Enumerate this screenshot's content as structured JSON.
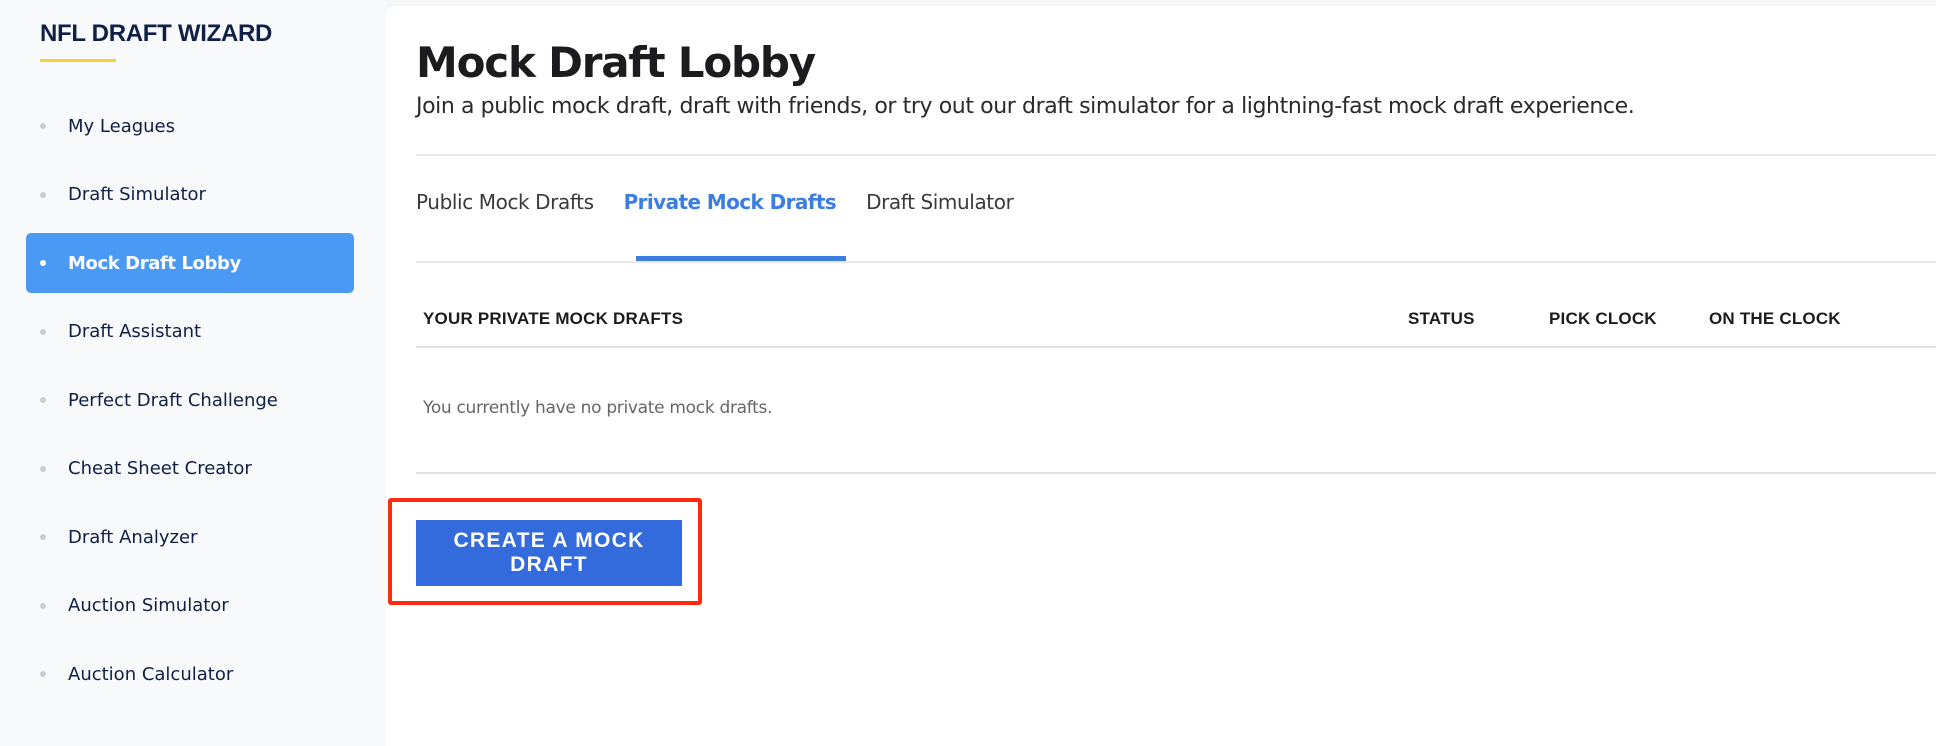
{
  "sidebar": {
    "logo": "NFL DRAFT WIZARD",
    "accent_color": "#f4cf3e",
    "active_color": "#4a9af5",
    "items": [
      {
        "label": "My Leagues",
        "active": false
      },
      {
        "label": "Draft Simulator",
        "active": false
      },
      {
        "label": "Mock Draft Lobby",
        "active": true
      },
      {
        "label": "Draft Assistant",
        "active": false
      },
      {
        "label": "Perfect Draft Challenge",
        "active": false
      },
      {
        "label": "Cheat Sheet Creator",
        "active": false
      },
      {
        "label": "Draft Analyzer",
        "active": false
      },
      {
        "label": "Auction Simulator",
        "active": false
      },
      {
        "label": "Auction Calculator",
        "active": false
      }
    ]
  },
  "main": {
    "title": "Mock Draft Lobby",
    "subtitle": "Join a public mock draft, draft with friends, or try out our draft simulator for a lightning-fast mock draft experience.",
    "tabs": [
      {
        "label": "Public Mock Drafts",
        "active": false
      },
      {
        "label": "Private Mock Drafts",
        "active": true
      },
      {
        "label": "Draft Simulator",
        "active": false
      }
    ],
    "tab_accent_color": "#3b7de0",
    "table": {
      "columns": [
        "YOUR PRIVATE MOCK DRAFTS",
        "STATUS",
        "PICK CLOCK",
        "ON THE CLOCK"
      ],
      "rows": [],
      "empty_message": "You currently have no private mock drafts."
    },
    "create_button": {
      "label": "CREATE A MOCK DRAFT",
      "color": "#336bdd",
      "highlighted": true,
      "highlight_color": "#ff2a12"
    }
  }
}
